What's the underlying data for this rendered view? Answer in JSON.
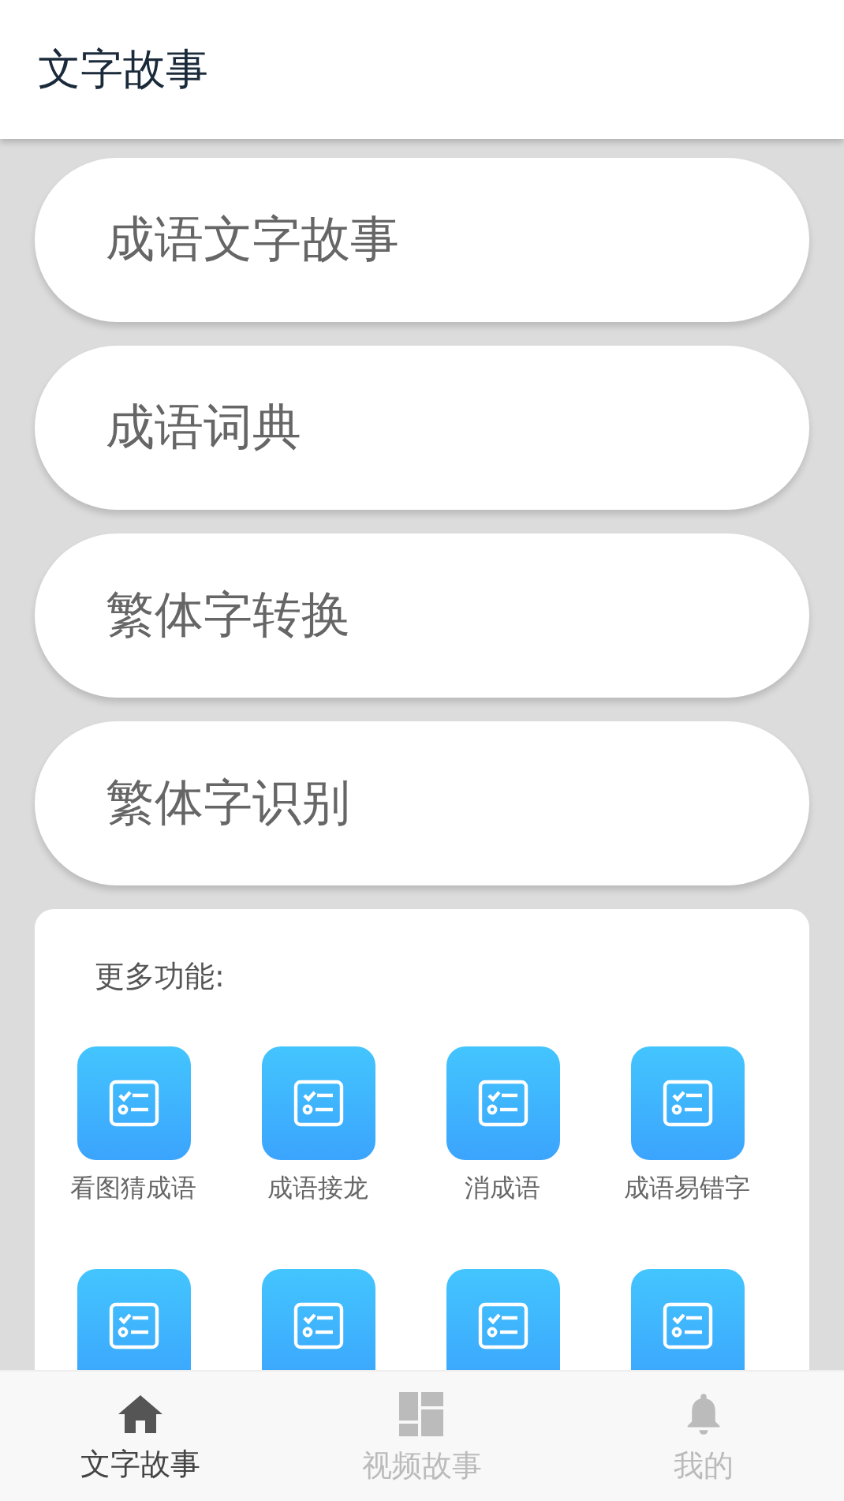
{
  "header": {
    "title": "文字故事"
  },
  "menu_items": [
    {
      "label": "成语文字故事"
    },
    {
      "label": "成语词典"
    },
    {
      "label": "繁体字转换"
    },
    {
      "label": "繁体字识别"
    }
  ],
  "more": {
    "title": "更多功能:",
    "tiles": [
      {
        "kind": "labeled",
        "label": "看图猜成语"
      },
      {
        "kind": "labeled",
        "label": "成语接龙"
      },
      {
        "kind": "labeled",
        "label": "消成语"
      },
      {
        "kind": "labeled",
        "label": "成语易错字"
      },
      {
        "kind": "icon"
      },
      {
        "kind": "icon"
      },
      {
        "kind": "icon"
      },
      {
        "kind": "icon"
      }
    ]
  },
  "tab_bar": [
    {
      "label": "文字故事",
      "selected": true
    },
    {
      "label": "视频故事",
      "selected": false
    },
    {
      "label": "我的",
      "selected": false
    }
  ]
}
